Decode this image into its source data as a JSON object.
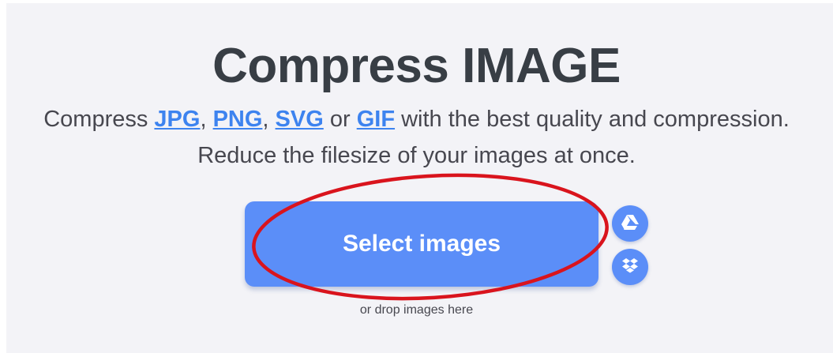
{
  "header": {
    "title": "Compress IMAGE"
  },
  "description": {
    "prefix": "Compress ",
    "formats": [
      "JPG",
      "PNG",
      "SVG",
      "GIF"
    ],
    "sep_comma": ", ",
    "sep_or": " or ",
    "suffix": " with the best quality and compression.",
    "line2": "Reduce the filesize of your images at once."
  },
  "upload": {
    "select_label": "Select images",
    "drop_hint": "or drop images here",
    "gdrive_icon": "google-drive-icon",
    "dropbox_icon": "dropbox-icon"
  },
  "colors": {
    "accent": "#5b8ef8",
    "link": "#3d83ef",
    "title": "#383e45",
    "annotation": "#d9141d"
  }
}
